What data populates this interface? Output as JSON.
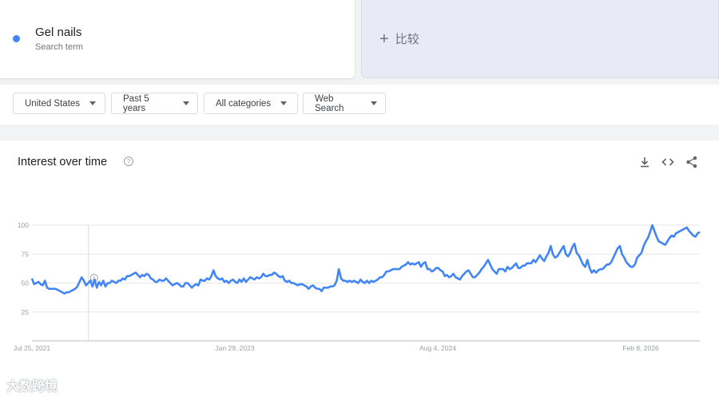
{
  "search_term": {
    "name": "Gel nails",
    "subtitle": "Search term",
    "color": "#4285f4"
  },
  "compare": {
    "plus": "+",
    "label": "比较"
  },
  "filters": [
    {
      "label": "United States"
    },
    {
      "label": "Past 5 years"
    },
    {
      "label": "All categories"
    },
    {
      "label": "Web Search"
    }
  ],
  "chart": {
    "title": "Interest over time",
    "help": "?",
    "icons": [
      "download-icon",
      "embed-code-icon",
      "share-icon"
    ]
  },
  "watermark": "大数跨境",
  "chart_data": {
    "type": "line",
    "title": "Interest over time",
    "xlabel": "",
    "ylabel": "",
    "ylim": [
      0,
      100
    ],
    "y_ticks": [
      25,
      50,
      75,
      100
    ],
    "x_ticks": [
      "Jul 25, 2021",
      "Jan 29, 2023",
      "Aug 4, 2024",
      "Feb 8, 2026"
    ],
    "x_range": [
      "2021-07-25",
      "2026-07-19"
    ],
    "grid": true,
    "legend": "none",
    "annotation_date": "2021-12-26",
    "series": [
      {
        "color": "#4285f4",
        "values": [
          54,
          49,
          50,
          51,
          49,
          48,
          52,
          46,
          45,
          45,
          45,
          45,
          44,
          43,
          42,
          41,
          42,
          42,
          43,
          44,
          45,
          47,
          51,
          55,
          52,
          48,
          50,
          52,
          47,
          53,
          46,
          51,
          48,
          52,
          47,
          50,
          50,
          52,
          51,
          50,
          52,
          52,
          54,
          53,
          56,
          56,
          57,
          58,
          59,
          57,
          55,
          57,
          56,
          58,
          57,
          54,
          53,
          51,
          51,
          53,
          52,
          52,
          54,
          52,
          50,
          48,
          49,
          50,
          49,
          47,
          47,
          50,
          50,
          48,
          46,
          48,
          49,
          48,
          53,
          52,
          52,
          54,
          53,
          56,
          61,
          56,
          54,
          53,
          54,
          51,
          52,
          50,
          52,
          53,
          51,
          50,
          53,
          51,
          54,
          51,
          53,
          55,
          54,
          53,
          55,
          54,
          55,
          58,
          56,
          56,
          57,
          57,
          59,
          58,
          56,
          55,
          56,
          52,
          51,
          52,
          50,
          50,
          49,
          48,
          49,
          49,
          48,
          47,
          45,
          47,
          48,
          46,
          45,
          45,
          43,
          46,
          46,
          46,
          47,
          47,
          48,
          52,
          62,
          54,
          52,
          52,
          51,
          52,
          51,
          52,
          51,
          50,
          53,
          51,
          50,
          52,
          50,
          52,
          51,
          52,
          53,
          55,
          55,
          57,
          60,
          60,
          61,
          62,
          62,
          62,
          62,
          64,
          65,
          66,
          68,
          66,
          67,
          66,
          67,
          68,
          64,
          67,
          68,
          62,
          62,
          60,
          61,
          63,
          63,
          61,
          60,
          56,
          57,
          55,
          56,
          58,
          55,
          54,
          53,
          56,
          58,
          60,
          61,
          58,
          55,
          55,
          57,
          59,
          62,
          64,
          67,
          70,
          66,
          62,
          60,
          58,
          62,
          62,
          62,
          60,
          64,
          62,
          63,
          65,
          67,
          63,
          63,
          65,
          65,
          67,
          67,
          67,
          70,
          68,
          71,
          74,
          71,
          69,
          73,
          76,
          82,
          75,
          72,
          73,
          76,
          79,
          82,
          75,
          73,
          76,
          81,
          84,
          76,
          74,
          70,
          66,
          64,
          70,
          63,
          59,
          61,
          59,
          61,
          62,
          62,
          64,
          66,
          66,
          68,
          72,
          76,
          80,
          82,
          75,
          72,
          68,
          66,
          64,
          64,
          66,
          72,
          74,
          76,
          82,
          86,
          89,
          94,
          100,
          95,
          90,
          86,
          85,
          84,
          83,
          86,
          89,
          91,
          90,
          93,
          94,
          95,
          96,
          97,
          98,
          95,
          93,
          91,
          90,
          93,
          94
        ]
      }
    ]
  }
}
